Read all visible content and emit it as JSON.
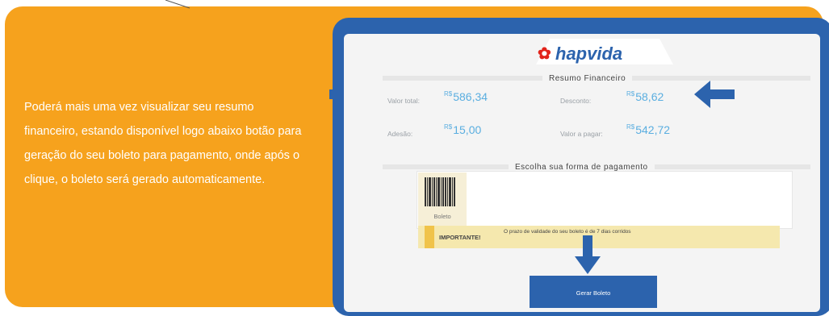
{
  "instructions": {
    "text": "Poderá mais uma vez visualizar seu resumo financeiro, estando disponível logo abaixo botão para geração do seu boleto para pagamento, onde após o clique, o boleto será gerado automaticamente."
  },
  "screen": {
    "logo_text": "hapvida",
    "logo_mark": "✿",
    "summary_title": "Resumo Financeiro",
    "fields": [
      {
        "label": "Valor total:",
        "currency": "R$",
        "value": "586,34"
      },
      {
        "label": "Desconto:",
        "currency": "R$",
        "value": "58,62"
      },
      {
        "label": "Adesão:",
        "currency": "R$",
        "value": "15,00"
      },
      {
        "label": "Valor a pagar:",
        "currency": "R$",
        "value": "542,72"
      }
    ],
    "payment_title": "Escolha sua forma de pagamento",
    "boleto_label": "Boleto",
    "notice_title": "IMPORTANTE!",
    "notice_text": "O prazo de validade do seu boleto é de 7 dias corridos",
    "generate_button": "Gerar Boleto"
  },
  "colors": {
    "background": "#f6a21d",
    "frame": "#2c63ad",
    "value_text": "#5aaee0",
    "notice": "#f5e8ae",
    "arrow": "#2c63ad"
  }
}
